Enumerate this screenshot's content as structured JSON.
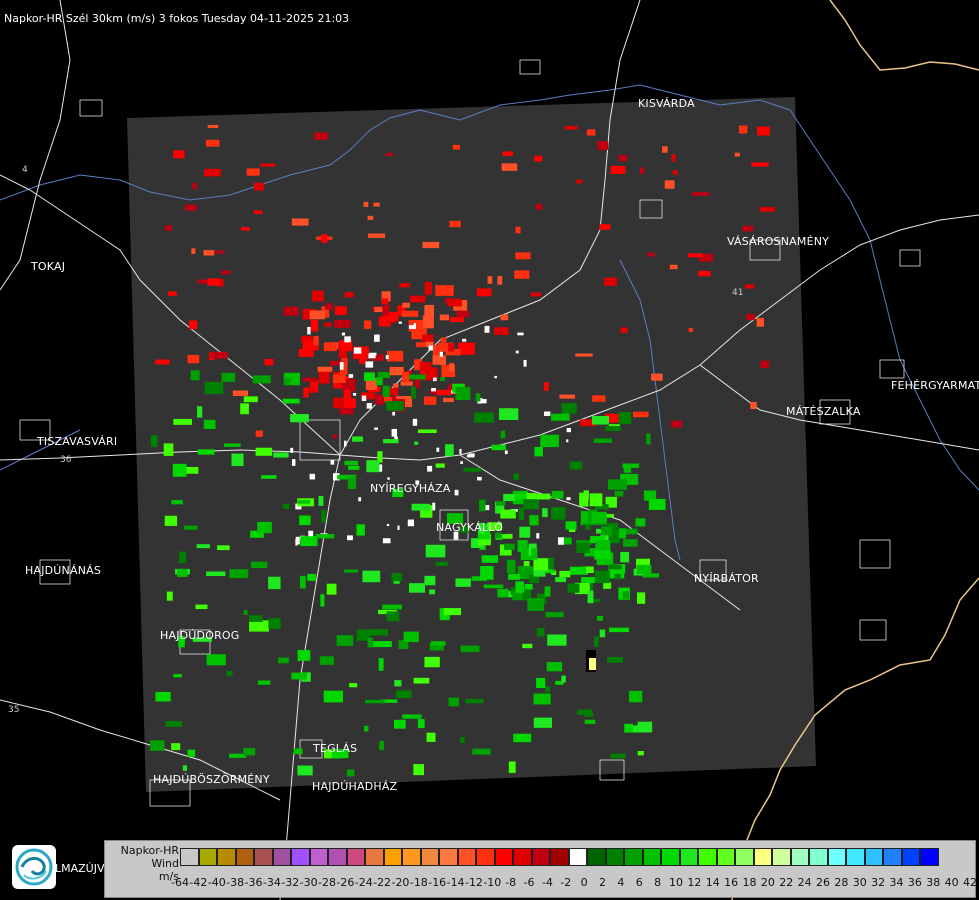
{
  "header": {
    "title": "Napkor-HR Szél 30km (m/s) 3 fokos Tuesday 04-11-2025 21:03"
  },
  "cities": [
    {
      "name": "KISVÁRDA"
    },
    {
      "name": "TOKAJ"
    },
    {
      "name": "VÁSÁROSNAMÉNY"
    },
    {
      "name": "FEHÉRGYARMAT"
    },
    {
      "name": "MÁTÉSZALKA"
    },
    {
      "name": "TISZAVASVÁRI"
    },
    {
      "name": "NYÍREGYHÁZA"
    },
    {
      "name": "NAGYKÁLLÓ"
    },
    {
      "name": "HAJDÚNÁNÁS"
    },
    {
      "name": "NYÍRBÁTOR"
    },
    {
      "name": "HAJDÚDOROG"
    },
    {
      "name": "TEGLÁS"
    },
    {
      "name": "HAJDÚBÖSZÖRMÉNY"
    },
    {
      "name": "HAJDÚHADHÁZ"
    }
  ],
  "road_labels": {
    "r1": "4",
    "r2": "41",
    "r3": "36",
    "r4": "35"
  },
  "logo": {
    "icon": "weather-logo-icon",
    "text": "LMAZÚJVAR"
  },
  "legend": {
    "title_line1": "Napkor-HR",
    "title_line2": "Wind",
    "title_line3": "m/s",
    "colors": [
      "#c8c8c8",
      "#a8a800",
      "#b88a00",
      "#b06010",
      "#a85050",
      "#a050a0",
      "#a050ff",
      "#c060d0",
      "#b050b0",
      "#d04880",
      "#e87840",
      "#ffa000",
      "#ff9820",
      "#f08840",
      "#ff7840",
      "#ff5028",
      "#ff3010",
      "#ff0000",
      "#e00000",
      "#c00010",
      "#a00000",
      "#ffffff",
      "#006400",
      "#008000",
      "#00a000",
      "#00c000",
      "#00d800",
      "#20e820",
      "#40ff00",
      "#60ff20",
      "#90ff60",
      "#ffff80",
      "#d0ffa0",
      "#a0ffc0",
      "#80ffd0",
      "#70ffff",
      "#40e8ff",
      "#30c0ff",
      "#2080ff",
      "#0040ff",
      "#0000ff"
    ],
    "labels": [
      "-64",
      "-42",
      "-40",
      "-38",
      "-36",
      "-34",
      "-32",
      "-30",
      "-28",
      "-26",
      "-24",
      "-22",
      "-20",
      "-18",
      "-16",
      "-14",
      "-12",
      "-10",
      "-8",
      "-6",
      "-4",
      "-2",
      "0",
      "2",
      "4",
      "6",
      "8",
      "10",
      "12",
      "14",
      "16",
      "18",
      "20",
      "22",
      "24",
      "26",
      "28",
      "30",
      "32",
      "34",
      "36",
      "38",
      "40",
      "42"
    ]
  }
}
